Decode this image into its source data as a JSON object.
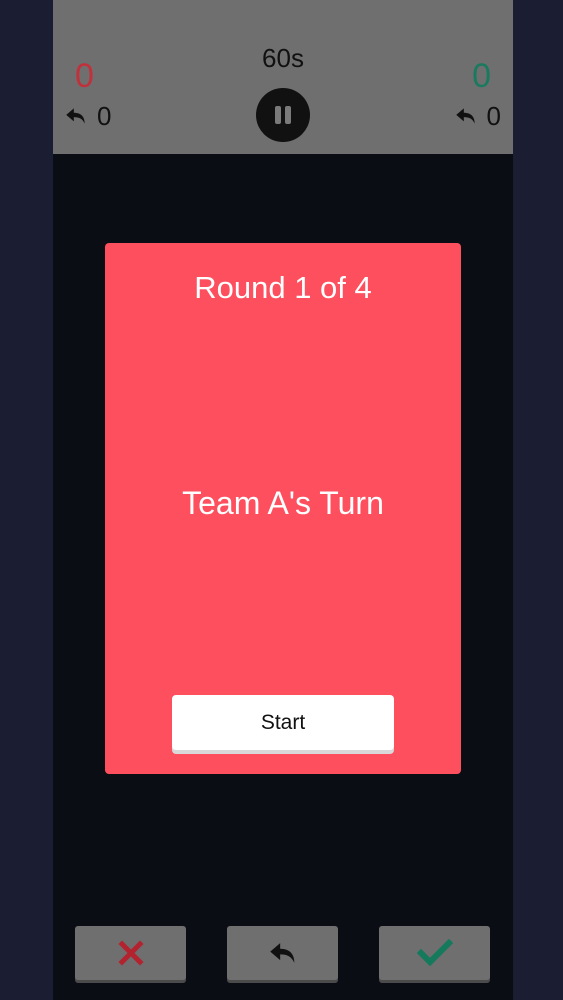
{
  "team_a": {
    "score": "0",
    "undos": "0",
    "color": "#c0313c"
  },
  "team_b": {
    "score": "0",
    "undos": "0",
    "color": "#1a7a5f"
  },
  "timer": {
    "label": "60s"
  },
  "card": {
    "round_label": "Round 1 of 4",
    "turn_label": "Team A's Turn",
    "start_label": "Start",
    "color": "#fe4f5f"
  },
  "icons": {
    "undo": "undo-arrow-icon",
    "pause": "pause-icon",
    "wrong": "x-icon",
    "correct": "checkmark-icon"
  }
}
